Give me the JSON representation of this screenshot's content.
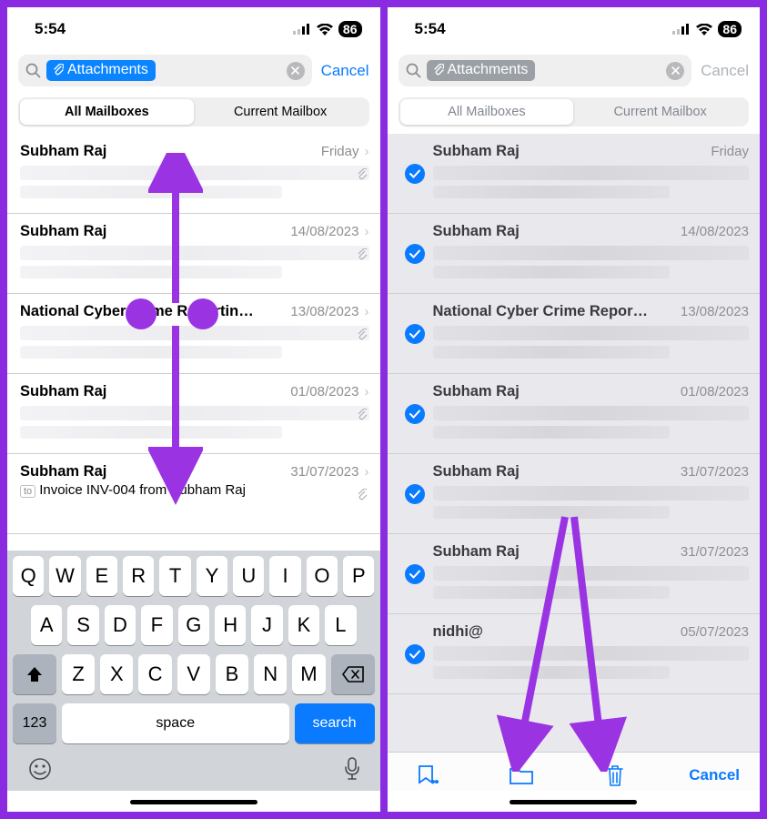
{
  "status": {
    "time": "5:54",
    "battery": "86"
  },
  "search": {
    "token_label": "Attachments",
    "cancel": "Cancel"
  },
  "segments": {
    "all": "All Mailboxes",
    "current": "Current Mailbox"
  },
  "left_emails": [
    {
      "sender": "Subham Raj",
      "date": "Friday"
    },
    {
      "sender": "Subham Raj",
      "date": "14/08/2023"
    },
    {
      "sender": "National Cyber Crime Reportin…",
      "date": "13/08/2023"
    },
    {
      "sender": "Subham Raj",
      "date": "01/08/2023"
    },
    {
      "sender": "Subham Raj",
      "date": "31/07/2023",
      "subject": "Invoice INV-004 from Subham Raj"
    }
  ],
  "right_emails": [
    {
      "sender": "Subham Raj",
      "date": "Friday"
    },
    {
      "sender": "Subham Raj",
      "date": "14/08/2023"
    },
    {
      "sender": "National Cyber Crime Repor…",
      "date": "13/08/2023"
    },
    {
      "sender": "Subham Raj",
      "date": "01/08/2023"
    },
    {
      "sender": "Subham Raj",
      "date": "31/07/2023"
    },
    {
      "sender": "Subham Raj",
      "date": "31/07/2023"
    },
    {
      "sender": "nidhi@",
      "date": "05/07/2023"
    }
  ],
  "keyboard": {
    "r1": [
      "Q",
      "W",
      "E",
      "R",
      "T",
      "Y",
      "U",
      "I",
      "O",
      "P"
    ],
    "r2": [
      "A",
      "S",
      "D",
      "F",
      "G",
      "H",
      "J",
      "K",
      "L"
    ],
    "r3": [
      "Z",
      "X",
      "C",
      "V",
      "B",
      "N",
      "M"
    ],
    "num": "123",
    "space": "space",
    "search": "search"
  },
  "toolbar": {
    "cancel": "Cancel"
  }
}
